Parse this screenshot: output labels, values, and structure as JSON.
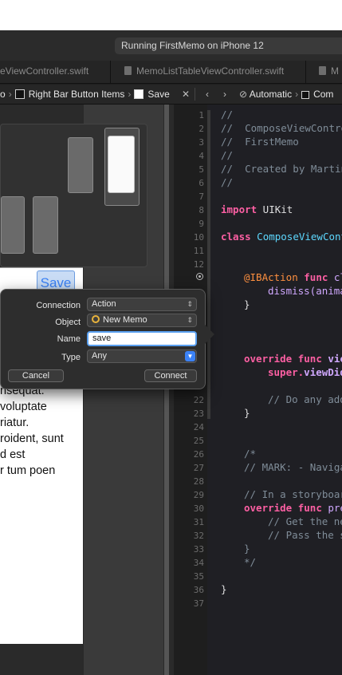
{
  "toolbar": {
    "activity": "Running FirstMemo on iPhone 12"
  },
  "tabs": [
    {
      "label": "eViewController.swift"
    },
    {
      "label": "MemoListTableViewController.swift"
    },
    {
      "label": "M"
    }
  ],
  "jumpbar": {
    "left": [
      "o",
      "Right Bar Button Items",
      "Save"
    ],
    "right": [
      "Automatic",
      "Com"
    ]
  },
  "storyboard": {
    "save_button": "Save",
    "lorem_lines": [
      "nsequat.",
      "voluptate",
      "riatur.",
      "roident, sunt",
      "d est",
      "r tum poen"
    ]
  },
  "popover": {
    "connection": {
      "label": "Connection",
      "value": "Action"
    },
    "object": {
      "label": "Object",
      "value": "New Memo"
    },
    "name": {
      "label": "Name",
      "value": "save"
    },
    "type": {
      "label": "Type",
      "value": "Any"
    },
    "cancel": "Cancel",
    "connect": "Connect"
  },
  "code": {
    "lines": [
      {
        "n": "1",
        "t": "//"
      },
      {
        "n": "2",
        "t": "//  ComposeViewContro"
      },
      {
        "n": "3",
        "t": "//  FirstMemo"
      },
      {
        "n": "4",
        "t": "//"
      },
      {
        "n": "5",
        "t": "//  Created by Martin"
      },
      {
        "n": "6",
        "t": "//"
      },
      {
        "n": "7",
        "t": ""
      },
      {
        "n": "8",
        "t": "import UIKit"
      },
      {
        "n": "9",
        "t": ""
      },
      {
        "n": "10",
        "t": "class ComposeViewCont"
      },
      {
        "n": "11",
        "t": ""
      },
      {
        "n": "12",
        "t": ""
      },
      {
        "n": "",
        "t": "@IBAction func cl"
      },
      {
        "n": "",
        "t": "dismiss(anima"
      },
      {
        "n": "",
        "t": "}"
      },
      {
        "n": "",
        "t": "override func vie"
      },
      {
        "n": "",
        "t": "super.viewDid"
      },
      {
        "n": "22",
        "t": "// Do any add"
      },
      {
        "n": "23",
        "t": "}"
      },
      {
        "n": "24",
        "t": ""
      },
      {
        "n": "25",
        "t": ""
      },
      {
        "n": "26",
        "t": "/*"
      },
      {
        "n": "27",
        "t": "// MARK: - Naviga"
      },
      {
        "n": "28",
        "t": ""
      },
      {
        "n": "29",
        "t": "// In a storyboar"
      },
      {
        "n": "30",
        "t": "override func pre"
      },
      {
        "n": "31",
        "t": "// Get the ne"
      },
      {
        "n": "32",
        "t": "// Pass the s"
      },
      {
        "n": "33",
        "t": "}"
      },
      {
        "n": "34",
        "t": "*/"
      },
      {
        "n": "35",
        "t": ""
      },
      {
        "n": "36",
        "t": "}"
      },
      {
        "n": "37",
        "t": ""
      }
    ]
  }
}
